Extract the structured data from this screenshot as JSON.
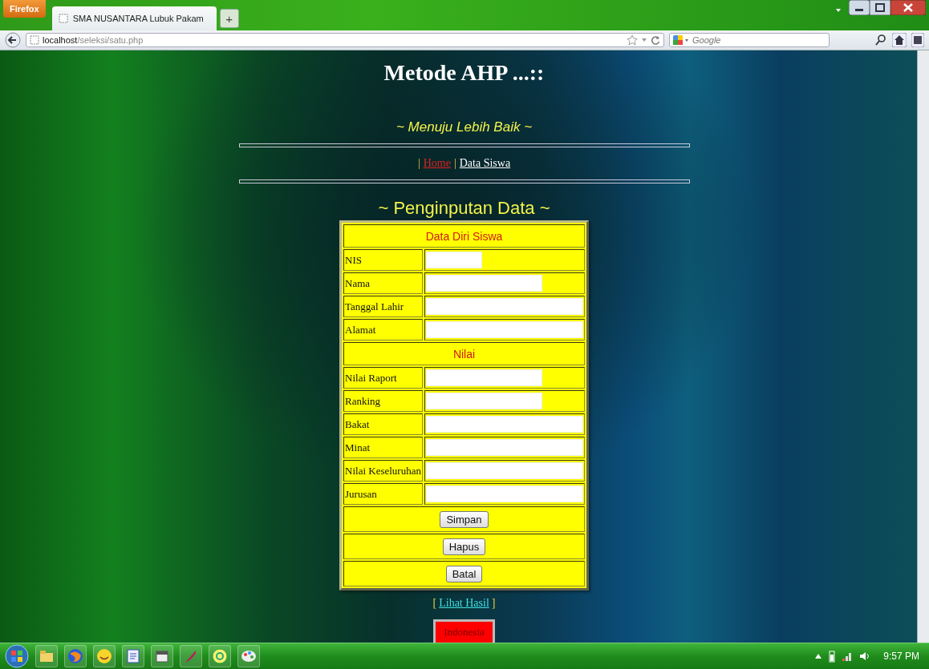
{
  "browser": {
    "menu_button": "Firefox",
    "tab": {
      "title": "SMA NUSANTARA Lubuk Pakam",
      "selected": true
    },
    "new_tab": "+",
    "address": {
      "host": "localhost",
      "path": "/seleksi/satu.php"
    },
    "search": {
      "placeholder": "Google"
    }
  },
  "page": {
    "title": "Metode AHP ...::",
    "tagline": "~ Menuju Lebih Baik ~",
    "nav": [
      {
        "kind": "separator",
        "text": "|"
      },
      {
        "kind": "link",
        "text": "Home",
        "selected": true
      },
      {
        "kind": "separator",
        "text": "|"
      },
      {
        "kind": "link",
        "text": "Data Siswa",
        "selected": false
      }
    ],
    "form_heading": "~ Penginputan Data ~",
    "form_rows": [
      {
        "kind": "section",
        "text": "Data Diri Siswa"
      },
      {
        "kind": "shortfield",
        "label": "NIS"
      },
      {
        "kind": "mediumfield",
        "label": "Nama"
      },
      {
        "kind": "longfield",
        "label": "Tanggal Lahir"
      },
      {
        "kind": "longfield",
        "label": "Alamat"
      },
      {
        "kind": "section",
        "text": "Nilai"
      },
      {
        "kind": "mediumfield",
        "label": "Nilai Raport"
      },
      {
        "kind": "mediumfield",
        "label": "Ranking"
      },
      {
        "kind": "longfield",
        "label": "Bakat"
      },
      {
        "kind": "longfield",
        "label": "Minat"
      },
      {
        "kind": "longfield",
        "label": "Nilai Keseluruhan"
      },
      {
        "kind": "longfield",
        "label": "Jurusan"
      },
      {
        "kind": "button",
        "text": "Simpan"
      },
      {
        "kind": "button",
        "text": "Hapus"
      },
      {
        "kind": "button",
        "text": "Batal"
      }
    ],
    "result_link": {
      "open": "[",
      "text": "Lihat Hasil",
      "close": "]"
    },
    "language_button": "Indonesia"
  },
  "taskbar": {
    "clock": "9:57 PM"
  }
}
